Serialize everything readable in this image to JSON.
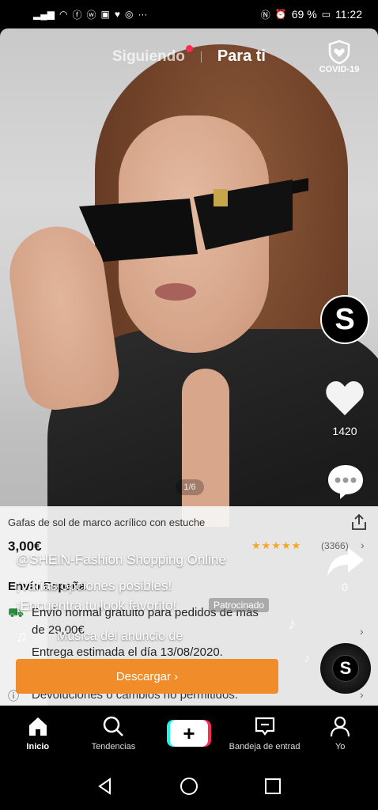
{
  "status_bar": {
    "battery": "69 %",
    "time": "11:22"
  },
  "tabs": {
    "following": "Siguiendo",
    "for_you": "Para ti",
    "covid": "COVID-19"
  },
  "video": {
    "page_indicator": "1/6"
  },
  "product": {
    "title": "Gafas de sol de marco acrílico con estuche",
    "price": "3,00€",
    "rating_stars": 4.5,
    "reviews": "(3366)",
    "shipping_title": "Envío España",
    "shipping_line1": "Envío normal gratuito para pedidos de más",
    "shipping_line2": "de 29,00€",
    "shipping_line3": "Entrega estimada el día 13/08/2020.",
    "returns": "Devoluciones o cambios no permitidos."
  },
  "caption": {
    "user": "@SHEIN-Fashion Shopping Online",
    "line1": "¡Varias opciones posibles!",
    "line2": "¡Encuentra tu look favorito!",
    "sponsored": "Patrocinado",
    "music": "Música del anuncio de"
  },
  "download_button": "Descargar ›",
  "rail": {
    "avatar_letter": "S",
    "likes": "1420",
    "shares": "0"
  },
  "bottom_nav": {
    "home": "Inicio",
    "trends": "Tendencias",
    "inbox": "Bandeja de entrad",
    "me": "Yo"
  },
  "colors": {
    "accent_red": "#fe2c55",
    "accent_cyan": "#25f4ee",
    "cta_orange": "#f08d2a"
  }
}
